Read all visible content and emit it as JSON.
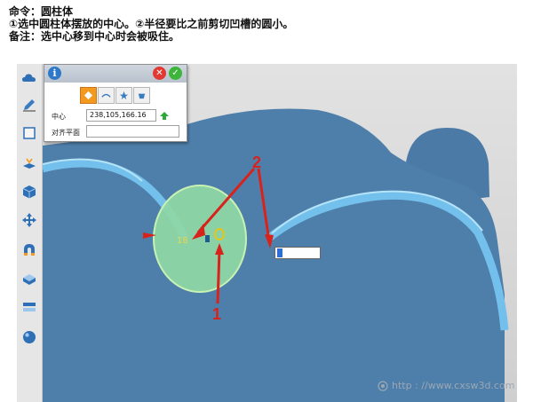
{
  "notes": {
    "line1": "命令：圆柱体",
    "line2": "①选中圆柱体摆放的中心。②半径要比之前剪切凹槽的圆小。",
    "line3": "备注：选中心移到中心时会被吸住。"
  },
  "toolbar": {
    "icons": [
      "cloud-icon",
      "pen-icon",
      "square-icon",
      "stack-icon",
      "cube-icon",
      "move-icon",
      "magnet-icon",
      "surface-icon",
      "layer-icon",
      "sphere-icon"
    ]
  },
  "panel": {
    "info_glyph": "i",
    "close_glyph": "✕",
    "ok_glyph": "✓",
    "center_label": "中心",
    "center_value": "238,105,166.16",
    "align_plane_label": "对齐平面",
    "align_plane_value": ""
  },
  "viewport": {
    "dimension_value": "18",
    "radius_value": "",
    "callout_1": "1",
    "callout_2": "2"
  },
  "watermark": {
    "text": "http : //www.cxsw3d.com"
  },
  "colors": {
    "model_blue": "#4e7faa",
    "rim_blue": "#73c0ec",
    "cylinder_green": "#8fd8a6",
    "callout_red": "#d8231c",
    "active_orange": "#f39a1e"
  }
}
